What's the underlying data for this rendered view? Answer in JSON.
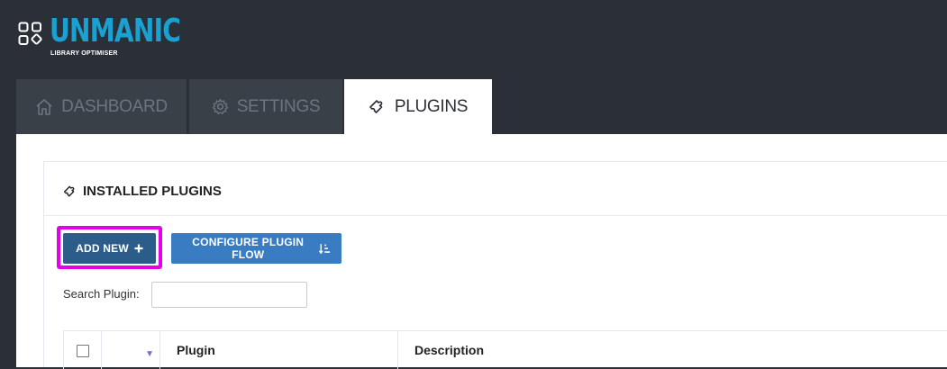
{
  "app": {
    "logo_text": "UNMANIC",
    "logo_subtitle": "LIBRARY OPTIMISER",
    "accent_color": "#1aa0d1"
  },
  "tabs": [
    {
      "label": "DASHBOARD",
      "icon": "home-icon",
      "active": false
    },
    {
      "label": "SETTINGS",
      "icon": "gear-icon",
      "active": false
    },
    {
      "label": "PLUGINS",
      "icon": "puzzle-icon",
      "active": true
    }
  ],
  "installed_plugins": {
    "title": "INSTALLED PLUGINS",
    "title_icon": "puzzle-icon",
    "add_new_label": "ADD NEW",
    "add_new_icon": "plus-icon",
    "configure_flow_label": "CONFIGURE PLUGIN FLOW",
    "configure_flow_icon": "sort-order-icon",
    "search_label": "Search Plugin:",
    "search_value": "",
    "search_placeholder": "",
    "highlight_color": "#e500e8"
  },
  "table": {
    "columns": [
      "",
      "",
      "Plugin",
      "Description"
    ],
    "sort_indicator": "▼"
  }
}
